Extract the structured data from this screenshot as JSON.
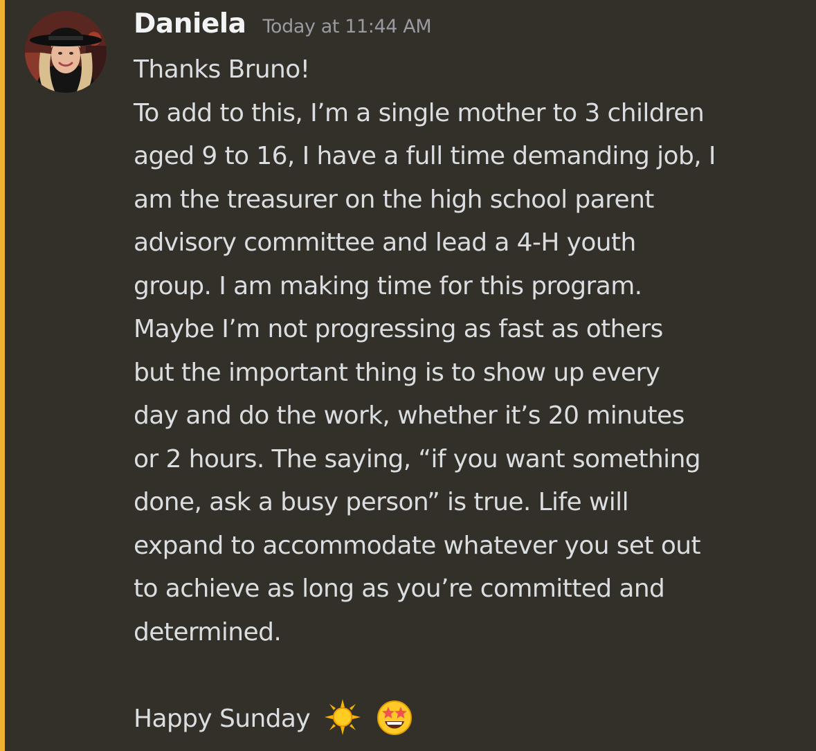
{
  "message": {
    "author": "Daniela",
    "timestamp": "Today at 11:44 AM",
    "lines": [
      "Thanks Bruno!",
      "To add to this, I’m a single mother to 3 children",
      "aged 9 to 16, I have a full time demanding job, I",
      "am the treasurer on the high school parent",
      "advisory committee and lead a 4-H youth",
      "group. I am making time for this program.",
      "Maybe I’m not progressing as fast as others",
      "but the important thing is to show up every",
      "day and do the work, whether it’s 20 minutes",
      "or 2 hours. The saying, “if you want something",
      "done, ask a busy person” is true. Life will",
      "expand to accommodate whatever you set out",
      "to achieve as long as you’re committed and",
      "determined."
    ],
    "closing": "Happy Sunday",
    "closing_emojis": [
      "sun-emoji",
      "star-struck-emoji"
    ]
  },
  "colors": {
    "background": "#33302a",
    "highlight_bar": "#f0b232",
    "author": "#f2f3f5",
    "timestamp": "#9a9aa0",
    "text": "#dbdee1"
  }
}
